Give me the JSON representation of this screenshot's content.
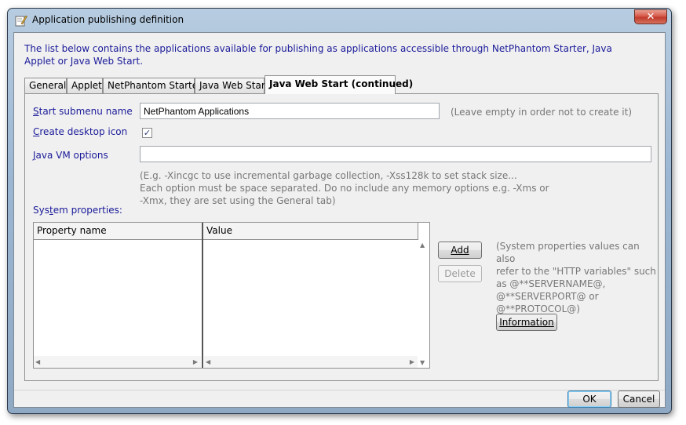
{
  "window": {
    "title": "Application publishing definition",
    "close_glyph": "✕",
    "app_icon": "pen-document-icon"
  },
  "intro_text": "The list below contains the applications available for publishing as applications accessible through NetPhantom Starter, Java Applet or Java Web Start.",
  "tabs": [
    {
      "label": "General",
      "active": false
    },
    {
      "label": "Applet",
      "active": false
    },
    {
      "label": "NetPhantom Starter",
      "active": false
    },
    {
      "label": "Java Web Start",
      "active": false
    },
    {
      "label": "Java Web Start (continued)",
      "active": true
    }
  ],
  "form": {
    "start_submenu": {
      "label_mnemonic": "S",
      "label_rest": "tart submenu name",
      "value": "NetPhantom Applications",
      "hint": "(Leave empty in order not to create it)"
    },
    "desktop_icon": {
      "label_mnemonic": "C",
      "label_rest": "reate desktop icon",
      "checked": true,
      "check_glyph": "✓"
    },
    "jvm_options": {
      "label_mnemonic": "J",
      "label_rest": "ava VM options",
      "value": "",
      "hint_lines": [
        "(E.g. -Xincgc to use incremental garbage collection, -Xss128k to set stack size...",
        "Each option must be space separated. Do no include any memory options e.g. -Xms or",
        "-Xmx, they are set using the General tab)"
      ]
    },
    "system_properties": {
      "label_before": "Sys",
      "label_mnemonic": "t",
      "label_after": "em properties:",
      "columns": [
        "Property name",
        "Value"
      ],
      "rows": [],
      "note_lines": [
        "(System properties values can also",
        "refer to the \"HTTP variables\" such",
        "as @**SERVERNAME@,",
        "@**SERVERPORT@ or",
        "@**PROTOCOL@)"
      ]
    }
  },
  "buttons": {
    "add": "Add",
    "delete": "Delete",
    "information": "Information",
    "ok": "OK",
    "cancel": "Cancel"
  },
  "scroll_arrows": {
    "left": "◀",
    "right": "▶",
    "up": "▲",
    "down": "▼"
  }
}
